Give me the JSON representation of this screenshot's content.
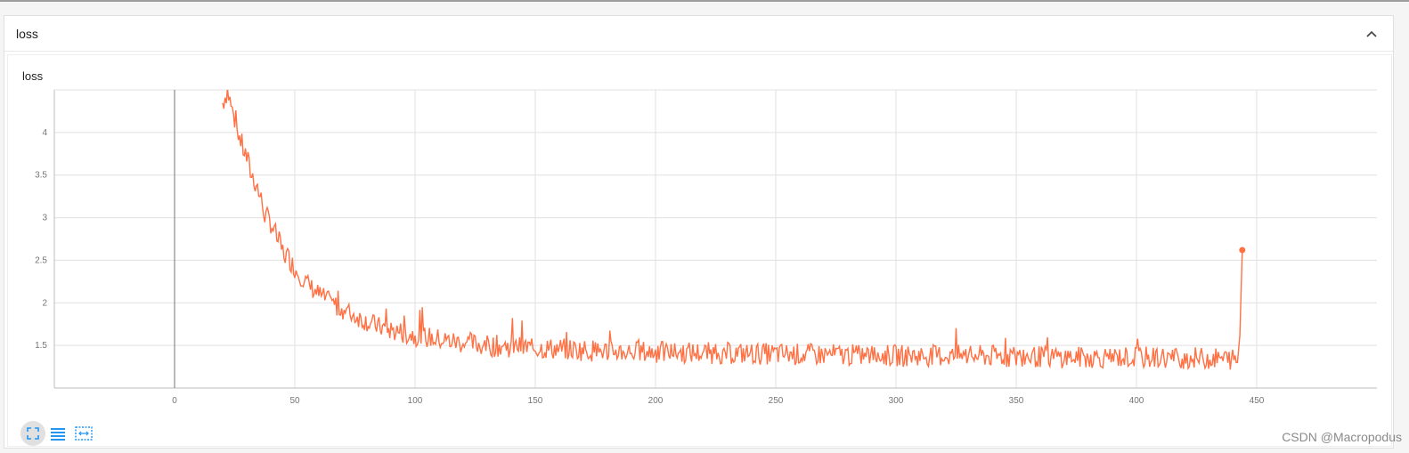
{
  "card": {
    "title": "loss",
    "collapse_icon": "chevron-up-icon"
  },
  "plot": {
    "title": "loss"
  },
  "toolbar": {
    "buttons": [
      {
        "icon": "fit-domain-icon",
        "active": true
      },
      {
        "icon": "list-icon",
        "active": false
      },
      {
        "icon": "toggle-y-log-icon",
        "active": false
      }
    ],
    "accent_color": "#2196f3"
  },
  "watermark": "CSDN @Macropodus",
  "chart_data": {
    "type": "line",
    "title": "loss",
    "xlabel": "",
    "ylabel": "",
    "xlim": [
      -50,
      500
    ],
    "ylim": [
      1.0,
      4.5
    ],
    "x_ticks": [
      0,
      50,
      100,
      150,
      200,
      250,
      300,
      350,
      400,
      450
    ],
    "y_ticks": [
      1.5,
      2,
      2.5,
      3,
      3.5,
      4
    ],
    "x_tick_labels": [
      "0",
      "50",
      "100",
      "150",
      "200",
      "250",
      "300",
      "350",
      "400",
      "450"
    ],
    "y_tick_labels": [
      "1.5",
      "2",
      "2.5",
      "3",
      "3.5",
      "4"
    ],
    "grid": true,
    "series": [
      {
        "color": "#ff7043",
        "points": [
          [
            20,
            4.35
          ],
          [
            22,
            4.5
          ],
          [
            24,
            4.25
          ],
          [
            26,
            4.05
          ],
          [
            28,
            3.85
          ],
          [
            30,
            3.7
          ],
          [
            32,
            3.5
          ],
          [
            34,
            3.4
          ],
          [
            36,
            3.2
          ],
          [
            38,
            3.0
          ],
          [
            40,
            2.95
          ],
          [
            42,
            2.8
          ],
          [
            45,
            2.6
          ],
          [
            48,
            2.5
          ],
          [
            50,
            2.4
          ],
          [
            53,
            2.3
          ],
          [
            56,
            2.2
          ],
          [
            60,
            2.1
          ],
          [
            65,
            2.0
          ],
          [
            70,
            1.92
          ],
          [
            75,
            1.85
          ],
          [
            80,
            1.78
          ],
          [
            85,
            1.72
          ],
          [
            90,
            1.68
          ],
          [
            100,
            1.62
          ],
          [
            110,
            1.57
          ],
          [
            120,
            1.53
          ],
          [
            130,
            1.5
          ],
          [
            150,
            1.47
          ],
          [
            175,
            1.44
          ],
          [
            200,
            1.42
          ],
          [
            225,
            1.41
          ],
          [
            250,
            1.4
          ],
          [
            275,
            1.39
          ],
          [
            300,
            1.38
          ],
          [
            325,
            1.38
          ],
          [
            350,
            1.37
          ],
          [
            375,
            1.36
          ],
          [
            400,
            1.36
          ],
          [
            425,
            1.35
          ],
          [
            440,
            1.34
          ],
          [
            442,
            1.3
          ],
          [
            443,
            1.62
          ],
          [
            444,
            2.62
          ]
        ]
      }
    ],
    "last_point": {
      "x": 444,
      "y": 2.62
    }
  }
}
